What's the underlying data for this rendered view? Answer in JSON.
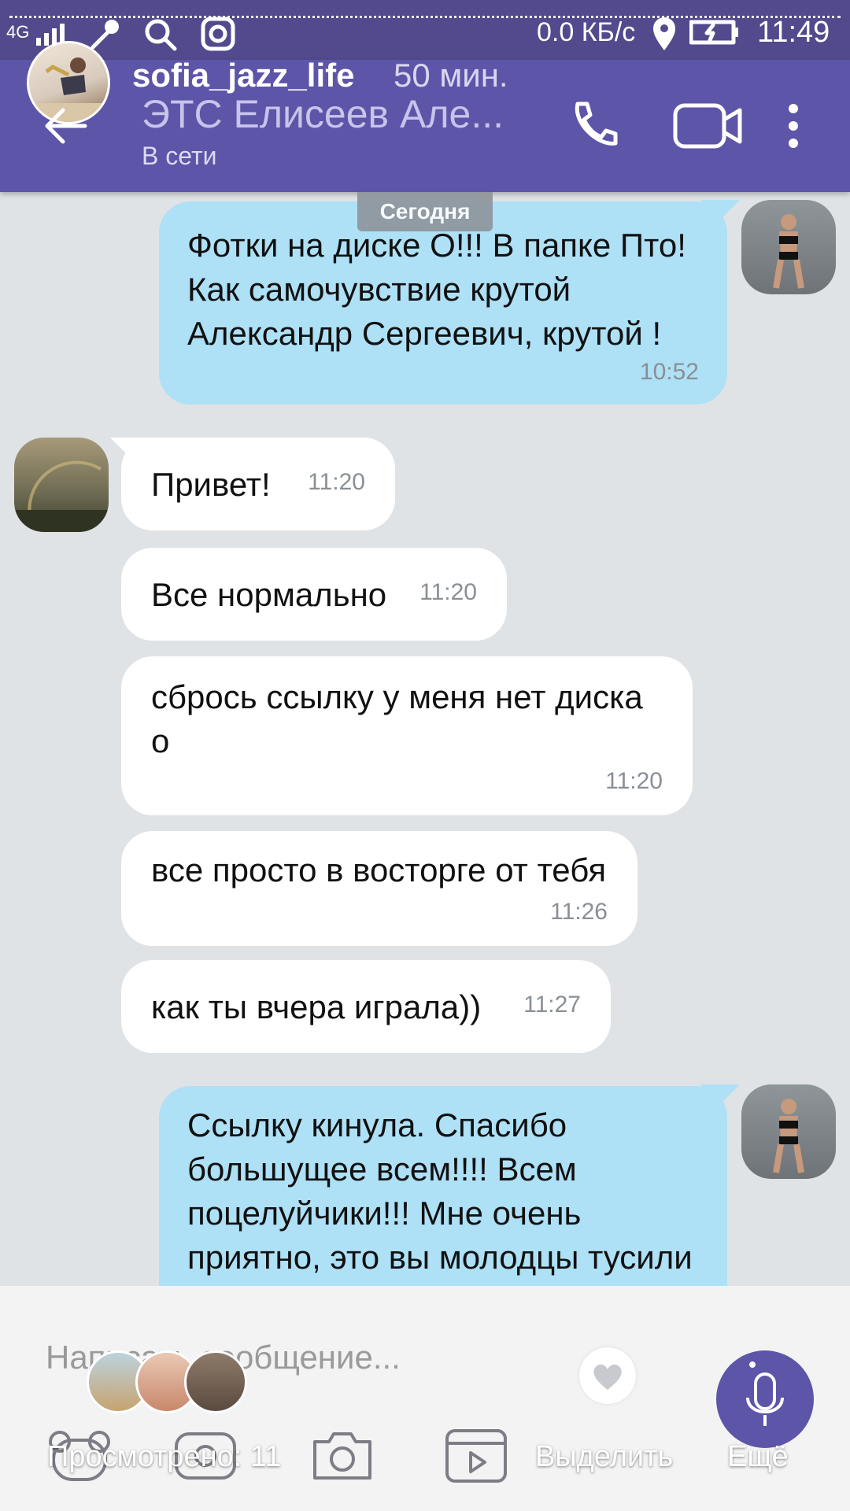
{
  "status_bar": {
    "network": "4G",
    "speed": "0.0 КБ/с",
    "time": "11:49"
  },
  "story": {
    "username": "sofia_jazz_life",
    "posted_ago": "50 мин.",
    "views_label": "Просмотрено: 11",
    "select_label": "Выделить",
    "more_label": "Ещё"
  },
  "header": {
    "contact_name": "ЭТС Елисеев Але...",
    "contact_status": "В сети"
  },
  "chat": {
    "date_separator": "Сегодня",
    "messages": [
      {
        "direction": "out",
        "text": "Фотки на диске О!!! В папке Пто!\nКак самочувствие крутой\nАлександр Сергеевич, крутой !",
        "time": "10:52"
      },
      {
        "direction": "in",
        "text": "Привет!",
        "time": "11:20"
      },
      {
        "direction": "in",
        "text": "Все нормально",
        "time": "11:20"
      },
      {
        "direction": "in",
        "text": "сбрось ссылку у меня нет диска\nо",
        "time": "11:20"
      },
      {
        "direction": "in",
        "text": "все просто в восторге от тебя",
        "time": "11:26"
      },
      {
        "direction": "in",
        "text": "как ты вчера играла))",
        "time": "11:27"
      },
      {
        "direction": "out",
        "text": "Ссылку кинула. Спасибо\nбольшущее всем!!!! Всем\nпоцелуйчики!!! Мне очень\nприятно, это вы молодцы тусили",
        "time": ""
      }
    ]
  },
  "composer": {
    "placeholder": "Написать сообщение..."
  },
  "icons": {
    "back": "arrow-left-icon",
    "call": "phone-icon",
    "video": "video-camera-icon",
    "menu": "more-vertical-icon",
    "mic": "microphone-icon",
    "heart": "heart-icon"
  },
  "colors": {
    "header": "#5d55a8",
    "outgoing_bubble": "#aee0f6",
    "incoming_bubble": "#ffffff",
    "chat_background": "#dfe3e6"
  }
}
